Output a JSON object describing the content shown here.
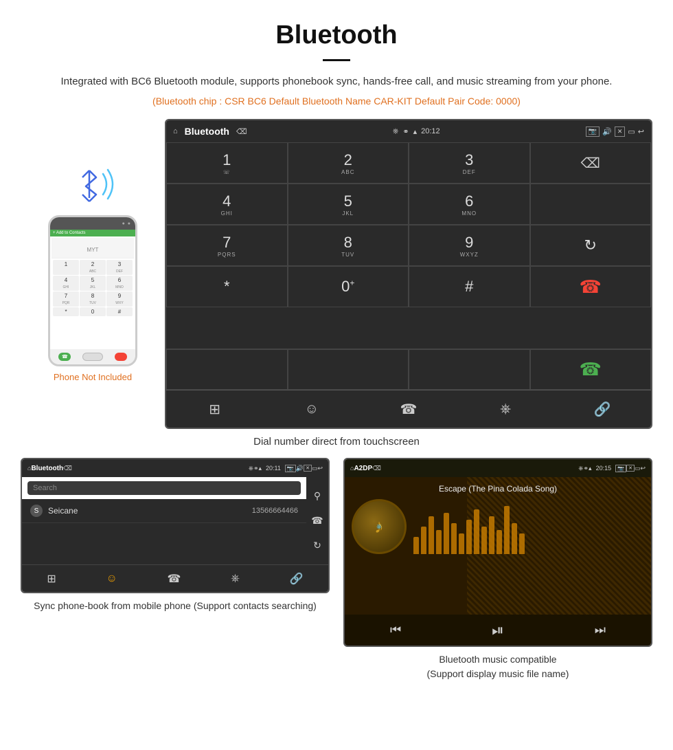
{
  "page": {
    "title": "Bluetooth",
    "description": "Integrated with BC6 Bluetooth module, supports phonebook sync, hands-free call, and music streaming from your phone.",
    "specs": "(Bluetooth chip : CSR BC6    Default Bluetooth Name CAR-KIT    Default Pair Code: 0000)",
    "main_caption": "Dial number direct from touchscreen",
    "phone_not_included": "Phone Not Included"
  },
  "statusbar": {
    "app_name": "Bluetooth",
    "time": "20:12",
    "time2": "20:11",
    "time3": "20:15",
    "a2dp": "A2DP"
  },
  "dialpad": {
    "keys": [
      {
        "num": "1",
        "sub": ""
      },
      {
        "num": "2",
        "sub": "ABC"
      },
      {
        "num": "3",
        "sub": "DEF"
      },
      {
        "num": "",
        "sub": ""
      },
      {
        "num": "4",
        "sub": "GHI"
      },
      {
        "num": "5",
        "sub": "JKL"
      },
      {
        "num": "6",
        "sub": "MNO"
      },
      {
        "num": "",
        "sub": ""
      },
      {
        "num": "7",
        "sub": "PQRS"
      },
      {
        "num": "8",
        "sub": "TUV"
      },
      {
        "num": "9",
        "sub": "WXYZ"
      },
      {
        "num": "",
        "sub": ""
      },
      {
        "num": "*",
        "sub": ""
      },
      {
        "num": "0",
        "sub": "+"
      },
      {
        "num": "#",
        "sub": ""
      },
      {
        "num": "",
        "sub": ""
      }
    ]
  },
  "phonebook": {
    "search_placeholder": "Search",
    "contact_name": "Seicane",
    "contact_number": "13566664466",
    "contact_letter": "S"
  },
  "music": {
    "song_title": "Escape (The Pina Colada Song)"
  },
  "bottom_captions": {
    "phonebook": "Sync phone-book from mobile phone\n(Support contacts searching)",
    "music": "Bluetooth music compatible\n(Support display music file name)"
  }
}
